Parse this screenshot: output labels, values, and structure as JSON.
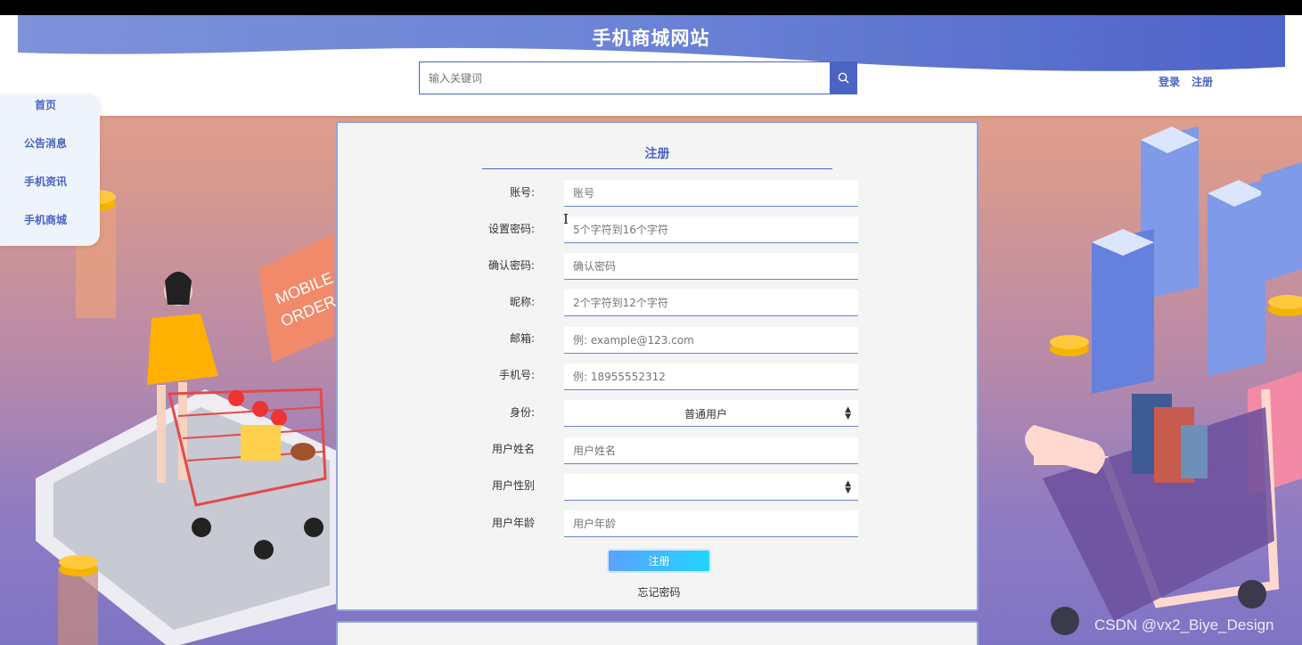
{
  "site": {
    "title": "手机商城网站",
    "search_placeholder": "输入关键词",
    "login_label": "登录",
    "register_label": "注册",
    "brand_color": "#4a63c4"
  },
  "sidebar": {
    "items": [
      {
        "label": "首页"
      },
      {
        "label": "公告消息"
      },
      {
        "label": "手机资讯"
      },
      {
        "label": "手机商城"
      }
    ]
  },
  "form": {
    "title": "注册",
    "fields": [
      {
        "label": "账号:",
        "placeholder": "账号"
      },
      {
        "label": "设置密码:",
        "placeholder": "5个字符到16个字符"
      },
      {
        "label": "确认密码:",
        "placeholder": "确认密码"
      },
      {
        "label": "昵称:",
        "placeholder": "2个字符到12个字符"
      },
      {
        "label": "邮箱:",
        "placeholder": "例: example@123.com"
      },
      {
        "label": "手机号:",
        "placeholder": "例: 18955552312"
      },
      {
        "label": "身份:",
        "value": "普通用户"
      },
      {
        "label": "用户姓名",
        "placeholder": "用户姓名"
      },
      {
        "label": "用户性别",
        "value": ""
      },
      {
        "label": "用户年龄",
        "placeholder": "用户年龄"
      }
    ],
    "submit_label": "注册",
    "forgot_label": "忘记密码"
  },
  "illustration": {
    "sign_text_1": "MOBILE",
    "sign_text_2": "ORDER"
  },
  "watermark": "CSDN @vx2_Biye_Design",
  "icons": [
    "search-icon",
    "select-arrow-icon",
    "text-cursor-icon"
  ]
}
